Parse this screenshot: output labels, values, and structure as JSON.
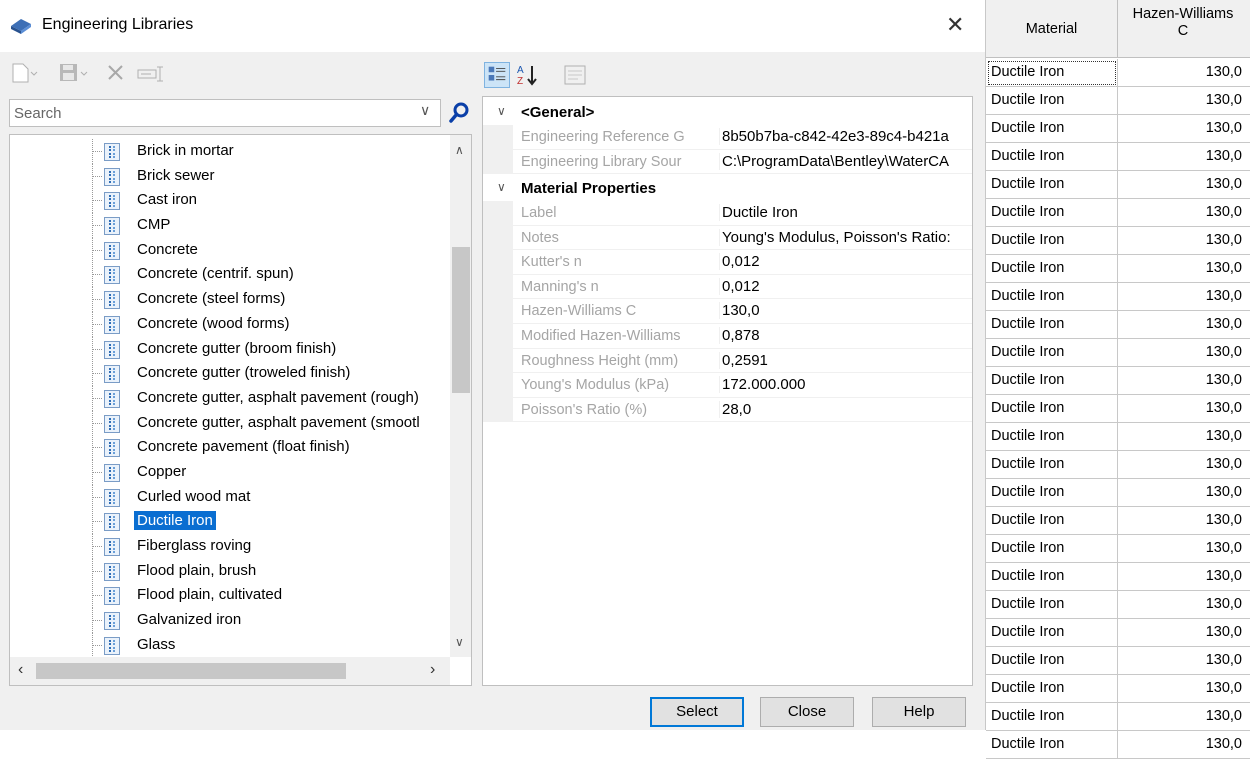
{
  "window": {
    "title": "Engineering Libraries",
    "close_glyph": "✕"
  },
  "search": {
    "placeholder": "Search"
  },
  "tree": {
    "items": [
      "Brick in mortar",
      "Brick sewer",
      "Cast iron",
      "CMP",
      "Concrete",
      "Concrete (centrif. spun)",
      "Concrete (steel forms)",
      "Concrete (wood forms)",
      "Concrete gutter (broom finish)",
      "Concrete gutter (troweled finish)",
      "Concrete gutter, asphalt pavement (rough)",
      "Concrete gutter, asphalt pavement (smootl",
      "Concrete pavement (float finish)",
      "Copper",
      "Curled wood mat",
      "Ductile Iron",
      "Fiberglass roving",
      "Flood plain, brush",
      "Flood plain, cultivated",
      "Galvanized iron",
      "Glass"
    ],
    "selected_index": 15
  },
  "property_grid": {
    "general": {
      "label": "<General>",
      "rows": [
        {
          "name": "Engineering Reference G",
          "value": "8b50b7ba-c842-42e3-89c4-b421a"
        },
        {
          "name": "Engineering Library Sour",
          "value": "C:\\ProgramData\\Bentley\\WaterCA"
        }
      ]
    },
    "material": {
      "label": "Material Properties",
      "rows": [
        {
          "name": "Label",
          "value": "Ductile Iron"
        },
        {
          "name": "Notes",
          "value": "Young's Modulus, Poisson's Ratio:"
        },
        {
          "name": "Kutter's n",
          "value": "0,012"
        },
        {
          "name": "Manning's n",
          "value": "0,012"
        },
        {
          "name": "Hazen-Williams C",
          "value": "130,0"
        },
        {
          "name": "Modified Hazen-Williams",
          "value": "0,878"
        },
        {
          "name": "Roughness Height (mm)",
          "value": "0,2591"
        },
        {
          "name": "Young's Modulus (kPa)",
          "value": "172.000.000"
        },
        {
          "name": "Poisson's Ratio (%)",
          "value": "28,0"
        }
      ]
    }
  },
  "buttons": {
    "select": "Select",
    "close": "Close",
    "help": "Help"
  },
  "table": {
    "headers": {
      "material": "Material",
      "hw_line1": "Hazen-Williams",
      "hw_line2": "C"
    },
    "rows": [
      {
        "material": "Ductile Iron",
        "hw": "130,0"
      },
      {
        "material": "Ductile Iron",
        "hw": "130,0"
      },
      {
        "material": "Ductile Iron",
        "hw": "130,0"
      },
      {
        "material": "Ductile Iron",
        "hw": "130,0"
      },
      {
        "material": "Ductile Iron",
        "hw": "130,0"
      },
      {
        "material": "Ductile Iron",
        "hw": "130,0"
      },
      {
        "material": "Ductile Iron",
        "hw": "130,0"
      },
      {
        "material": "Ductile Iron",
        "hw": "130,0"
      },
      {
        "material": "Ductile Iron",
        "hw": "130,0"
      },
      {
        "material": "Ductile Iron",
        "hw": "130,0"
      },
      {
        "material": "Ductile Iron",
        "hw": "130,0"
      },
      {
        "material": "Ductile Iron",
        "hw": "130,0"
      },
      {
        "material": "Ductile Iron",
        "hw": "130,0"
      },
      {
        "material": "Ductile Iron",
        "hw": "130,0"
      },
      {
        "material": "Ductile Iron",
        "hw": "130,0"
      },
      {
        "material": "Ductile Iron",
        "hw": "130,0"
      },
      {
        "material": "Ductile Iron",
        "hw": "130,0"
      },
      {
        "material": "Ductile Iron",
        "hw": "130,0"
      },
      {
        "material": "Ductile Iron",
        "hw": "130,0"
      },
      {
        "material": "Ductile Iron",
        "hw": "130,0"
      },
      {
        "material": "Ductile Iron",
        "hw": "130,0"
      },
      {
        "material": "Ductile Iron",
        "hw": "130,0"
      },
      {
        "material": "Ductile Iron",
        "hw": "130,0"
      },
      {
        "material": "Ductile Iron",
        "hw": "130,0"
      },
      {
        "material": "Ductile Iron",
        "hw": "130,0"
      }
    ]
  }
}
